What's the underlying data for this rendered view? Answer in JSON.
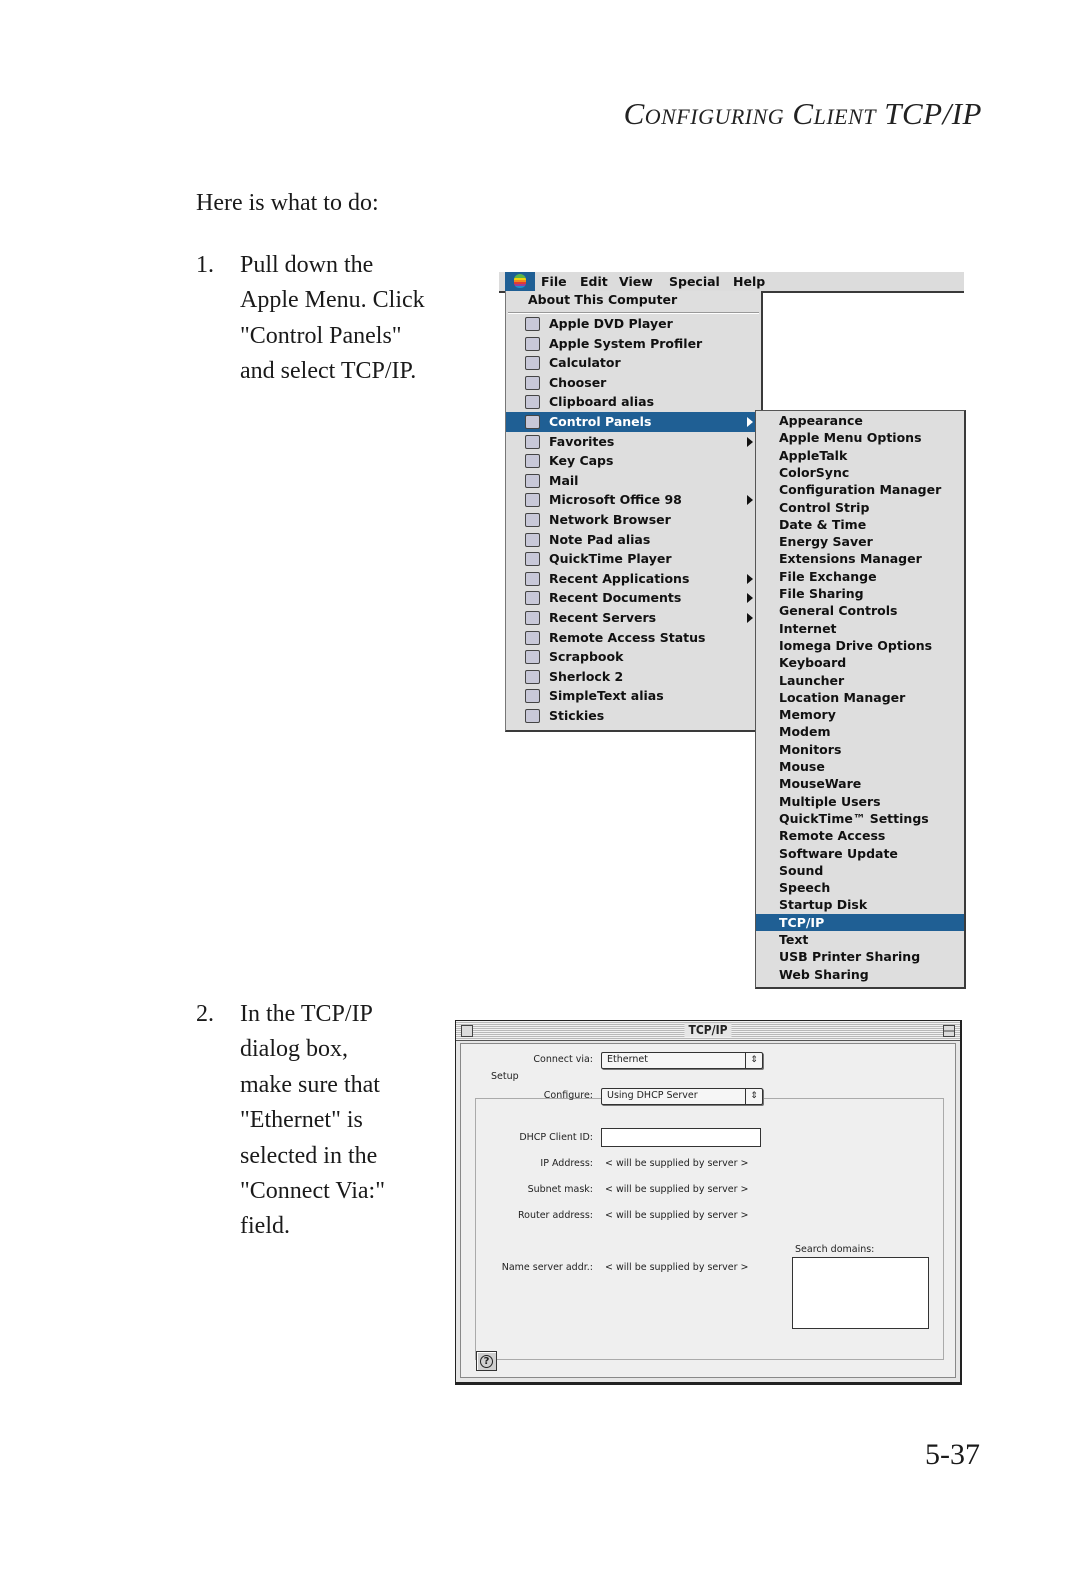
{
  "page": {
    "running_head": {
      "caps_word_1": "Configuring",
      "caps_word_2": "Client",
      "tail": "TCP/IP"
    },
    "intro": "Here is what to do:",
    "steps": [
      {
        "number": "1.",
        "text": "Pull down the\nApple Menu. Click\n\"Control Panels\"\nand select TCP/IP."
      },
      {
        "number": "2.",
        "text": "In the TCP/IP\ndialog box,\nmake sure that\n\"Ethernet\" is\nselected in the\n\"Connect Via:\"\nfield."
      }
    ],
    "page_number": "5-37"
  },
  "menu_screenshot": {
    "menubar": [
      "File",
      "Edit",
      "View",
      "Special",
      "Help"
    ],
    "apple_menu": {
      "about": "About This Computer",
      "items": [
        {
          "label": "Apple DVD Player",
          "icon": "dvd-icon",
          "submenu": false
        },
        {
          "label": "Apple System Profiler",
          "icon": "profiler-icon",
          "submenu": false
        },
        {
          "label": "Calculator",
          "icon": "calculator-icon",
          "submenu": false
        },
        {
          "label": "Chooser",
          "icon": "chooser-icon",
          "submenu": false
        },
        {
          "label": "Clipboard alias",
          "icon": "clipboard-icon",
          "submenu": false
        },
        {
          "label": "Control Panels",
          "icon": "folder-icon",
          "submenu": true,
          "highlighted": true
        },
        {
          "label": "Favorites",
          "icon": "folder-icon",
          "submenu": true
        },
        {
          "label": "Key Caps",
          "icon": "keycaps-icon",
          "submenu": false
        },
        {
          "label": "Mail",
          "icon": "mail-icon",
          "submenu": false
        },
        {
          "label": "Microsoft Office 98",
          "icon": "folder-icon",
          "submenu": true
        },
        {
          "label": "Network Browser",
          "icon": "network-icon",
          "submenu": false
        },
        {
          "label": "Note Pad alias",
          "icon": "notepad-icon",
          "submenu": false
        },
        {
          "label": "QuickTime Player",
          "icon": "quicktime-icon",
          "submenu": false
        },
        {
          "label": "Recent Applications",
          "icon": "folder-icon",
          "submenu": true
        },
        {
          "label": "Recent Documents",
          "icon": "folder-icon",
          "submenu": true
        },
        {
          "label": "Recent Servers",
          "icon": "folder-icon",
          "submenu": true
        },
        {
          "label": "Remote Access Status",
          "icon": "remote-access-icon",
          "submenu": false
        },
        {
          "label": "Scrapbook",
          "icon": "scrapbook-icon",
          "submenu": false
        },
        {
          "label": "Sherlock 2",
          "icon": "sherlock-icon",
          "submenu": false
        },
        {
          "label": "SimpleText alias",
          "icon": "simpletext-icon",
          "submenu": false
        },
        {
          "label": "Stickies",
          "icon": "stickies-icon",
          "submenu": false
        }
      ]
    },
    "control_panels_menu": {
      "items": [
        "Appearance",
        "Apple Menu Options",
        "AppleTalk",
        "ColorSync",
        "Configuration Manager",
        "Control Strip",
        "Date & Time",
        "Energy Saver",
        "Extensions Manager",
        "File Exchange",
        "File Sharing",
        "General Controls",
        "Internet",
        "Iomega Drive Options",
        "Keyboard",
        "Launcher",
        "Location Manager",
        "Memory",
        "Modem",
        "Monitors",
        "Mouse",
        "MouseWare",
        "Multiple Users",
        "QuickTime™ Settings",
        "Remote Access",
        "Software Update",
        "Sound",
        "Speech",
        "Startup Disk",
        "TCP/IP",
        "Text",
        "USB Printer Sharing",
        "Web Sharing"
      ],
      "highlighted": "TCP/IP"
    },
    "highlight_color": "#1f5f94"
  },
  "tcpip_dialog": {
    "title": "TCP/IP",
    "connect_via_label": "Connect via:",
    "connect_via_value": "Ethernet",
    "setup_label": "Setup",
    "configure_label": "Configure:",
    "configure_value": "Using DHCP Server",
    "dhcp_client_id_label": "DHCP Client ID:",
    "dhcp_client_id_value": "",
    "ip_address_label": "IP Address:",
    "ip_address_value": "< will be supplied by server >",
    "subnet_mask_label": "Subnet mask:",
    "subnet_mask_value": "< will be supplied by server >",
    "router_address_label": "Router address:",
    "router_address_value": "< will be supplied by server >",
    "name_server_label": "Name server addr.:",
    "name_server_value": "< will be supplied by server >",
    "search_domains_label": "Search domains:",
    "search_domains_value": "",
    "help_button": "?"
  }
}
